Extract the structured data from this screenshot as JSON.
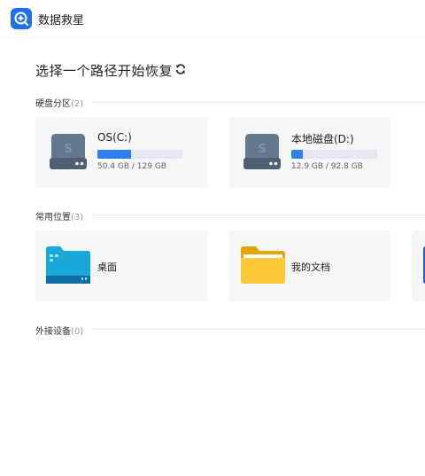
{
  "app": {
    "title": "数据救星",
    "logo_icon": "plus-circle-icon",
    "accent": "#1e6fe8"
  },
  "main": {
    "title": "选择一个路径开始恢复",
    "refresh_icon": "refresh-icon"
  },
  "sections": {
    "drives": {
      "label": "硬盘分区",
      "count": "(2)",
      "items": [
        {
          "name": "OS(C:)",
          "size_text": "50.4 GB / 129 GB",
          "usage": 0.39,
          "icon": "hard-drive-icon"
        },
        {
          "name": "本地磁盘(D:)",
          "size_text": "12.9 GB / 92.8 GB",
          "usage": 0.139,
          "icon": "hard-drive-icon"
        }
      ]
    },
    "common": {
      "label": "常用位置",
      "count": "(3)",
      "items": [
        {
          "label": "桌面",
          "icon": "desktop-folder-icon",
          "color": "#1aa7d9"
        },
        {
          "label": "我的文档",
          "icon": "documents-folder-icon",
          "color": "#f6bd16"
        },
        {
          "label": "",
          "icon": "folder-icon",
          "color": "#2f5bd8"
        }
      ]
    },
    "external": {
      "label": "外接设备",
      "count": "(0)"
    }
  }
}
